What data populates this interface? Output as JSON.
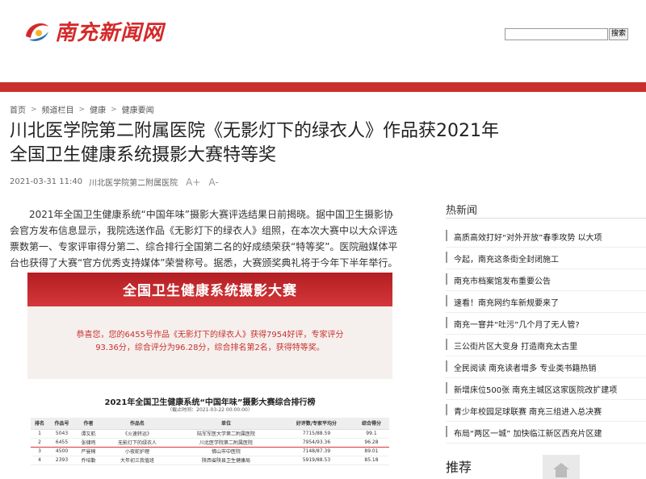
{
  "header": {
    "logo_text": "南充新闻网",
    "search_placeholder": "",
    "search_button": "搜索"
  },
  "colors": {
    "brand_red": "#c9302c",
    "banner_red": "#b21e22"
  },
  "breadcrumb": [
    "首页",
    "频道栏目",
    "健康",
    "健康要闻"
  ],
  "article": {
    "title_line1": "川北医学院第二附属医院《无影灯下的绿衣人》作品获2021年",
    "title_line2": "全国卫生健康系统摄影大赛特等奖",
    "datetime": "2021-03-31 11:40",
    "source": "川北医学院第二附属医院",
    "font_increase": "A+",
    "font_decrease": "A-",
    "paragraph": "2021年全国卫生健康系统“中国年味”摄影大赛评选结果日前揭晓。据中国卫生摄影协会官方发布信息显示，我院选送作品《无影灯下的绿衣人》组照，在本次大赛中以大众评选票数第一、专家评审得分第二、综合排行全国第二名的好成绩荣获“特等奖”。医院融媒体平台也获得了大赛“官方优秀支持媒体”荣誉称号。据悉，大赛颁奖典礼将于今年下半年举行。"
  },
  "image": {
    "banner": "全国卫生健康系统摄影大赛",
    "notice": "恭喜您，您的6455号作品《无影灯下的绿衣人》获得7954好评，专家评分93.36分，综合评分为96.28分，综合排名第2名，获得特等奖。",
    "rank_title": "2021年全国卫生健康系统“中国年味”摄影大赛综合排行榜",
    "rank_sub": "（截止时间：2021-03-22 00:00:00）",
    "headers": [
      "排名",
      "作品号",
      "作者",
      "作品名",
      "单位",
      "好评数/专家平均分",
      "综合得分"
    ],
    "rows": [
      [
        "1",
        "5043",
        "谭又航",
        "《火速转运》",
        "陆军军医大学第二附属医院",
        "7715/88.59",
        "99.1"
      ],
      [
        "2",
        "6455",
        "张储鸣",
        "无影灯下的绿衣人",
        "川北医学院第二附属医院",
        "7954/93.36",
        "96.28"
      ],
      [
        "3",
        "4500",
        "严曼楠",
        "小夜蛇护理",
        "佛山市中医院",
        "7148/87.39",
        "89.01"
      ],
      [
        "4",
        "2393",
        "乔培勤",
        "大年初三我值班",
        "陕西省陕县卫生健康局",
        "5919/88.53",
        "85.18"
      ]
    ]
  },
  "sidebar": {
    "hot_heading": "热新闻",
    "hot_items": [
      "高质高效打好“对外开放”春季攻势 以大项",
      "今起，南充这条街全封闭施工",
      "南充市档案馆发布重要公告",
      "速看！南充网约车新规要来了",
      "南充一窨井“吐污”几个月了无人管?",
      "三公街片区大变身 打造南充太古里",
      "全民阅读 南充读者增多 专业类书籍热销",
      "新增床位500张 南充主城区这家医院改扩建项",
      "青少年校园足球联赛 南充三组进入总决赛",
      "布局“两区一城” 加快临江新区西充片区建"
    ],
    "recommend_heading": "推荐"
  }
}
